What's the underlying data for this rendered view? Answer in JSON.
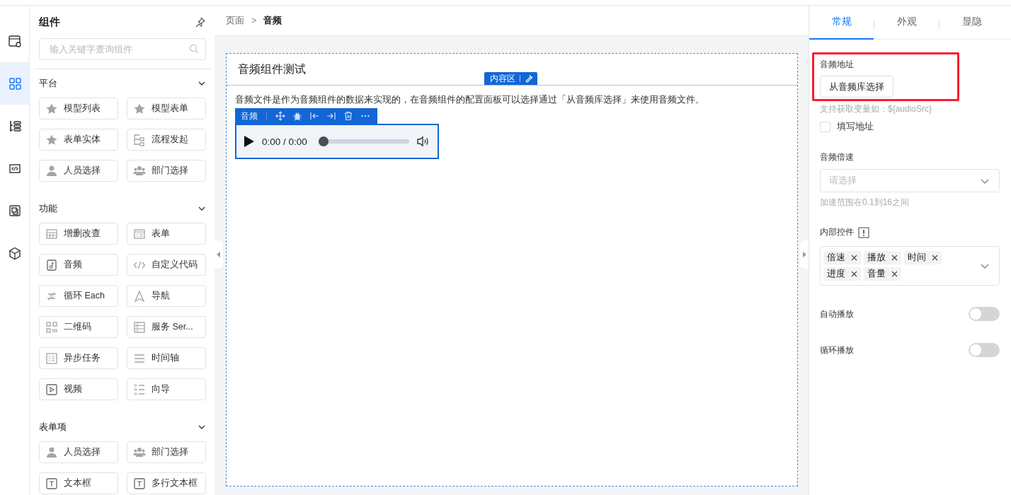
{
  "rail": [
    {
      "kind": "window-gear",
      "selected": false
    },
    {
      "kind": "grid",
      "selected": true
    },
    {
      "kind": "tree",
      "selected": false
    },
    {
      "kind": "code",
      "selected": false
    },
    {
      "kind": "layers",
      "selected": false
    },
    {
      "kind": "cube",
      "selected": false
    }
  ],
  "components_panel": {
    "title": "组件",
    "search": {
      "placeholder": "输入关键字查询组件"
    },
    "sections": [
      {
        "title": "平台",
        "expanded": true,
        "items": [
          {
            "label": "模型列表",
            "kind": "star"
          },
          {
            "label": "模型表单",
            "kind": "star"
          },
          {
            "label": "表单实体",
            "kind": "star"
          },
          {
            "label": "流程发起",
            "kind": "flow"
          },
          {
            "label": "人员选择",
            "kind": "person"
          },
          {
            "label": "部门选择",
            "kind": "people"
          }
        ]
      },
      {
        "title": "功能",
        "expanded": true,
        "items": [
          {
            "label": "增删改查",
            "kind": "table"
          },
          {
            "label": "表单",
            "kind": "form"
          },
          {
            "label": "音频",
            "kind": "audio"
          },
          {
            "label": "自定义代码",
            "kind": "code"
          },
          {
            "label": "循环 Each",
            "kind": "loop"
          },
          {
            "label": "导航",
            "kind": "nav"
          },
          {
            "label": "二维码",
            "kind": "qr"
          },
          {
            "label": "服务 Ser...",
            "kind": "service"
          },
          {
            "label": "异步任务",
            "kind": "task"
          },
          {
            "label": "时间轴",
            "kind": "timeline"
          },
          {
            "label": "视频",
            "kind": "video"
          },
          {
            "label": "向导",
            "kind": "steps"
          }
        ]
      },
      {
        "title": "表单项",
        "expanded": true,
        "items": [
          {
            "label": "人员选择",
            "kind": "person"
          },
          {
            "label": "部门选择",
            "kind": "people"
          },
          {
            "label": "文本框",
            "kind": "text"
          },
          {
            "label": "多行文本框",
            "kind": "text"
          }
        ]
      }
    ]
  },
  "breadcrumb": {
    "items": [
      "页面",
      "音频"
    ],
    "separator": ">"
  },
  "canvas": {
    "title": "音频组件测试",
    "content_tag": "内容区",
    "paragraph": "音频文件是作为音频组件的数据来实现的，在音频组件的配置面板可以选择通过「从音频库选择」来使用音频文件。",
    "component_toolbar": {
      "label": "音频",
      "actions": [
        {
          "kind": "move"
        },
        {
          "kind": "debug"
        },
        {
          "kind": "align-left"
        },
        {
          "kind": "align-right"
        },
        {
          "kind": "delete"
        },
        {
          "kind": "more"
        }
      ]
    },
    "player": {
      "time": "0:00 / 0:00",
      "level": 0
    }
  },
  "settings": {
    "tabs": [
      {
        "label": "常规",
        "selected": true
      },
      {
        "label": "外观",
        "selected": false
      },
      {
        "label": "显隐",
        "selected": false
      }
    ],
    "audio_source": {
      "label": "音频地址",
      "highlighted": true,
      "button": "从音频库选择",
      "hint": "支持获取变量如：${audioSrc}",
      "checkbox": {
        "label": "填写地址",
        "checked": false
      }
    },
    "speed": {
      "label": "音频倍速",
      "placeholder": "请选择",
      "hint": "加速范围在0.1到16之间"
    },
    "controls": {
      "label": "内部控件",
      "tags": [
        "倍速",
        "播放",
        "时间",
        "进度",
        "音量"
      ]
    },
    "switches": [
      {
        "label": "自动播放",
        "on": false
      },
      {
        "label": "循环播放",
        "on": false
      }
    ]
  }
}
